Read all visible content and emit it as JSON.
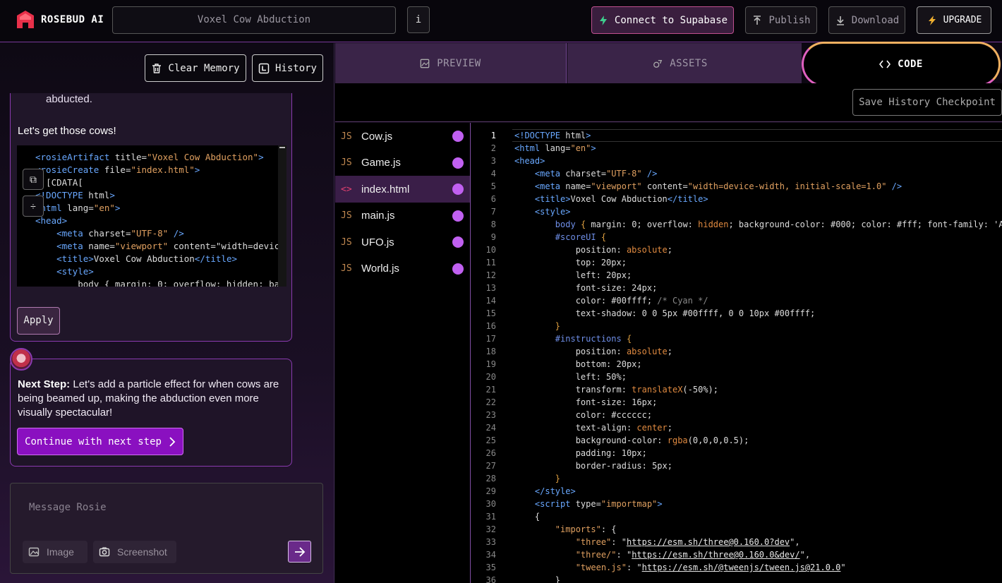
{
  "header": {
    "brand": "ROSEBUD AI",
    "project_title": "Voxel Cow Abduction",
    "info_label": "i",
    "connect_label": "Connect to Supabase",
    "publish_label": "Publish",
    "download_label": "Download",
    "upgrade_label": "UPGRADE"
  },
  "left": {
    "clear_memory_label": "Clear Memory",
    "history_label": "History",
    "message_tail": "abducted.",
    "message_line": "Let's get those cows!",
    "apply_label": "Apply",
    "next_step_label": "Next Step:",
    "next_step_text": " Let's add a particle effect for when cows are being beamed up, making the abduction even more visually spectacular!",
    "continue_label": "Continue with next step",
    "composer_placeholder": "Message Rosie",
    "image_label": "Image",
    "screenshot_label": "Screenshot"
  },
  "tabs": {
    "preview": "PREVIEW",
    "assets": "ASSETS",
    "code": "CODE"
  },
  "checkpoint_label": "Save History Checkpoint",
  "files": [
    {
      "type": "JS",
      "name": "Cow.js"
    },
    {
      "type": "JS",
      "name": "Game.js"
    },
    {
      "type": "<>",
      "name": "index.html"
    },
    {
      "type": "JS",
      "name": "main.js"
    },
    {
      "type": "JS",
      "name": "UFO.js"
    },
    {
      "type": "JS",
      "name": "World.js"
    }
  ],
  "active_file": "index.html",
  "snippet_lines": [
    "<rosieArtifact title=\"Voxel Cow Abduction\">",
    "<rosieCreate file=\"index.html\">",
    "<![CDATA[",
    "<!DOCTYPE html>",
    "<html lang=\"en\">",
    "<head>",
    "    <meta charset=\"UTF-8\" />",
    "    <meta name=\"viewport\" content=\"width=device-w",
    "    <title>Voxel Cow Abduction</title>",
    "    <style>",
    "        body { margin: 0; overflow: hidden; backg"
  ],
  "code_lines": [
    "<!DOCTYPE html>",
    "<html lang=\"en\">",
    "<head>",
    "    <meta charset=\"UTF-8\" />",
    "    <meta name=\"viewport\" content=\"width=device-width, initial-scale=1.0\" />",
    "    <title>Voxel Cow Abduction</title>",
    "    <style>",
    "        body { margin: 0; overflow: hidden; background-color: #000; color: #fff; font-family: 'A",
    "        #scoreUI {",
    "            position: absolute;",
    "            top: 20px;",
    "            left: 20px;",
    "            font-size: 24px;",
    "            color: #00ffff; /* Cyan */",
    "            text-shadow: 0 0 5px #00ffff, 0 0 10px #00ffff;",
    "        }",
    "        #instructions {",
    "            position: absolute;",
    "            bottom: 20px;",
    "            left: 50%;",
    "            transform: translateX(-50%);",
    "            font-size: 16px;",
    "            color: #cccccc;",
    "            text-align: center;",
    "            background-color: rgba(0,0,0,0.5);",
    "            padding: 10px;",
    "            border-radius: 5px;",
    "        }",
    "    </style>",
    "    <script type=\"importmap\">",
    "    {",
    "        \"imports\": {",
    "            \"three\": \"https://esm.sh/three@0.160.0?dev\",",
    "            \"three/\": \"https://esm.sh/three@0.160.0&dev/\",",
    "            \"tween.js\": \"https://esm.sh/@tweenjs/tween.js@21.0.0\"",
    "        }"
  ],
  "colors": {
    "accent": "#8a10c0",
    "file_dot": "#c060f0",
    "code_tab_ring": "#f0b060"
  }
}
